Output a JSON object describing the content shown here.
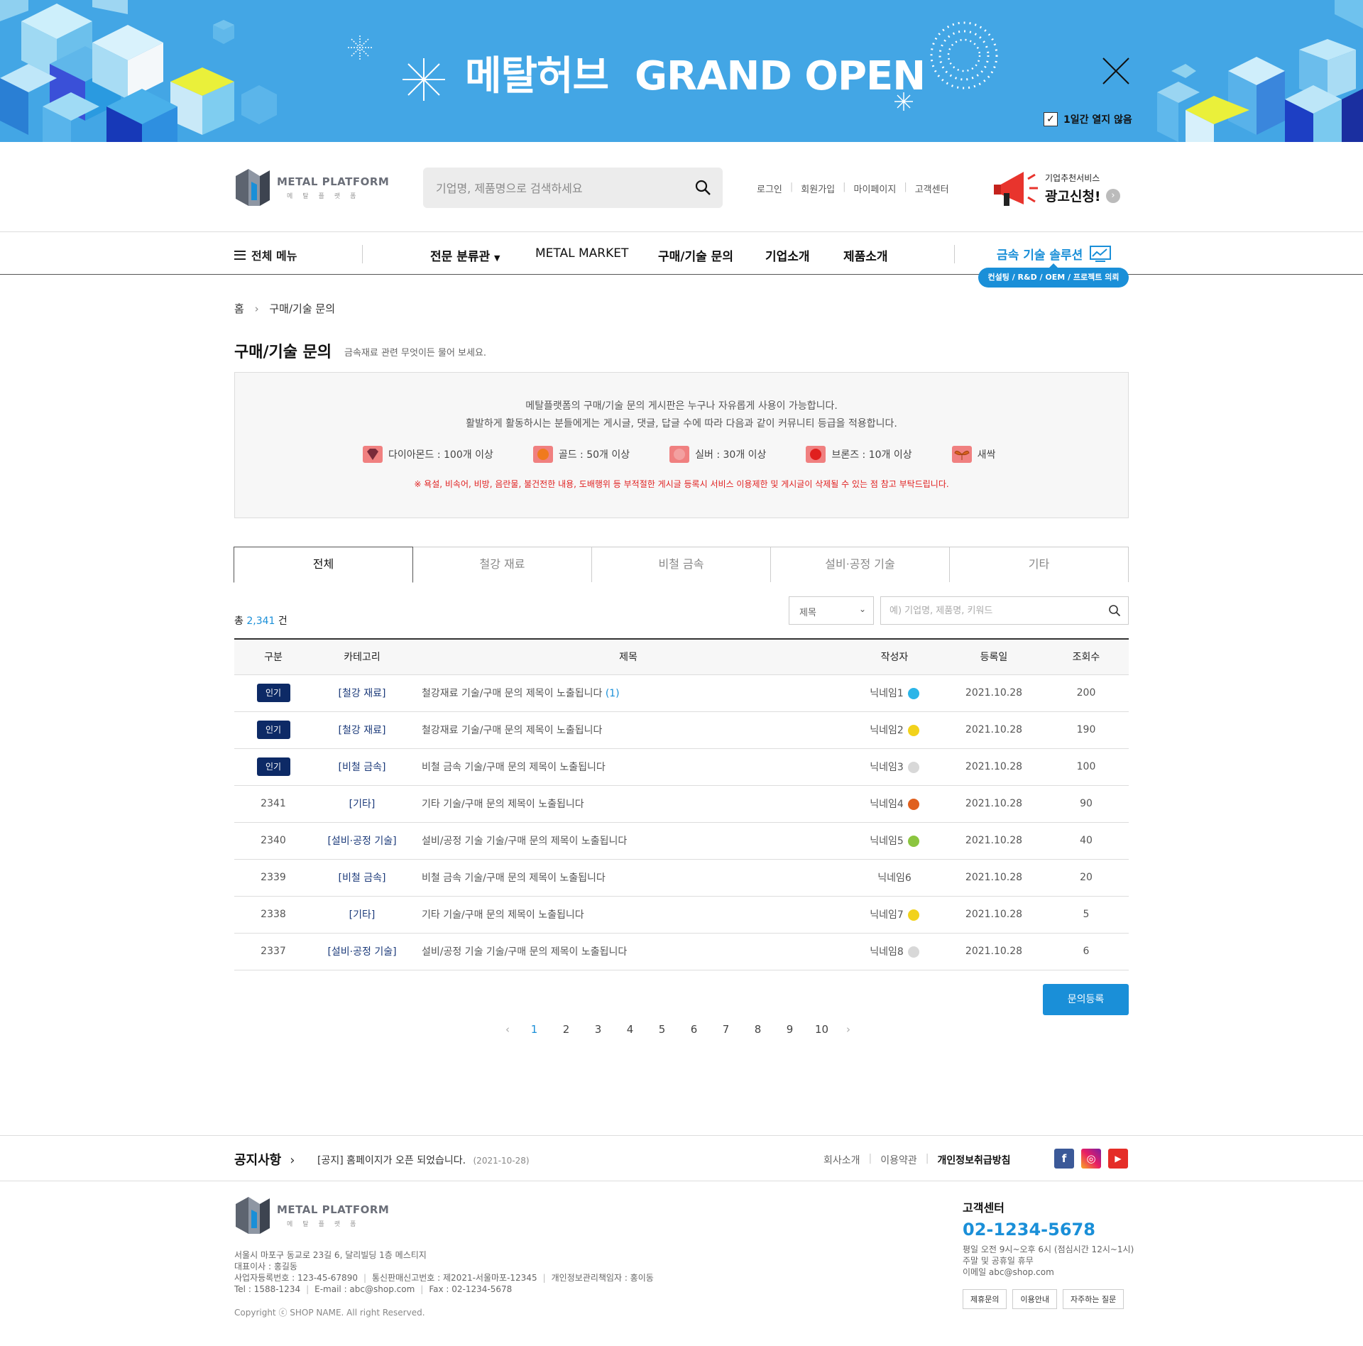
{
  "banner": {
    "title_kr": "메탈허브",
    "title_en": "GRAND OPEN",
    "no_show_label": "1일간 열지 않음",
    "close_icon": "close-icon"
  },
  "header": {
    "logo_text": "METAL PLATFORM",
    "logo_sub": "메탈플랫폼",
    "search_placeholder": "기업명, 제품명으로 검색하세요",
    "util_links": [
      "로그인",
      "회원가입",
      "마이페이지",
      "고객센터"
    ],
    "ad_sub": "기업추천서비스",
    "ad_main": "광고신청!"
  },
  "gnb": {
    "all_menu": "전체 메뉴",
    "menus": [
      "전문 분류관",
      "METAL MARKET",
      "구매/기술 문의",
      "기업소개",
      "제품소개"
    ],
    "solution": "금속 기술 솔루션",
    "solution_pill": "컨설팅 / R&D / OEM / 프로젝트 의뢰"
  },
  "breadcrumb": {
    "home": "홈",
    "current": "구매/기술 문의"
  },
  "page": {
    "title": "구매/기술 문의",
    "subtitle": "금속재료 관련 무엇이든 물어 보세요."
  },
  "info_box": {
    "line1": "메탈플랫폼의 구매/기술 문의 게시판은 누구나 자유롭게 사용이 가능합니다.",
    "line2": "활발하게 활동하시는 분들에게는 게시글, 댓글, 답글 수에 따라 다음과 같이 커뮤니티 등급을 적용합니다.",
    "grades": [
      "다이아몬드 : 100개 이상",
      "골드 : 50개 이상",
      "실버 : 30개 이상",
      "브론즈 : 10개 이상",
      "새싹"
    ],
    "warning": "※ 욕설, 비속어, 비방, 음란물, 불건전한 내용, 도배행위 등 부적절한 게시글 등록시 서비스 이용제한 및 게시글이 삭제될 수 있는 점 참고 부탁드립니다."
  },
  "tabs": [
    "전체",
    "철강 재료",
    "비철 금속",
    "설비·공정 기술",
    "기타"
  ],
  "board": {
    "total_prefix": "총",
    "total": "2,341",
    "total_suffix": "건",
    "select_value": "제목",
    "search_placeholder": "예) 기업명, 제품명, 키워드",
    "headers": [
      "구분",
      "카테고리",
      "제목",
      "작성자",
      "등록일",
      "조회수"
    ],
    "rows": [
      {
        "no": "인기",
        "hot": true,
        "cat": "[철강 재료]",
        "title": "철강재료 기술/구매 문의 제목이 노출됩니다",
        "comments": "(1)",
        "writer": "닉네임1",
        "level": "diamond",
        "date": "2021.10.28",
        "views": "200"
      },
      {
        "no": "인기",
        "hot": true,
        "cat": "[철강 재료]",
        "title": "철강재료 기술/구매 문의 제목이 노출됩니다",
        "comments": "",
        "writer": "닉네임2",
        "level": "gold",
        "date": "2021.10.28",
        "views": "190"
      },
      {
        "no": "인기",
        "hot": true,
        "cat": "[비철 금속]",
        "title": "비철 금속 기술/구매 문의 제목이 노출됩니다",
        "comments": "",
        "writer": "닉네임3",
        "level": "silver",
        "date": "2021.10.28",
        "views": "100"
      },
      {
        "no": "2341",
        "hot": false,
        "cat": "[기타]",
        "title": "기타 기술/구매 문의 제목이 노출됩니다",
        "comments": "",
        "writer": "닉네임4",
        "level": "bronze",
        "date": "2021.10.28",
        "views": "90"
      },
      {
        "no": "2340",
        "hot": false,
        "cat": "[설비·공정 기술]",
        "title": "설비/공정 기술 기술/구매 문의 제목이 노출됩니다",
        "comments": "",
        "writer": "닉네임5",
        "level": "sprout",
        "date": "2021.10.28",
        "views": "40"
      },
      {
        "no": "2339",
        "hot": false,
        "cat": "[비철 금속]",
        "title": "비철 금속 기술/구매 문의 제목이 노출됩니다",
        "comments": "",
        "writer": "닉네임6",
        "level": "none",
        "date": "2021.10.28",
        "views": "20"
      },
      {
        "no": "2338",
        "hot": false,
        "cat": "[기타]",
        "title": "기타 기술/구매 문의 제목이 노출됩니다",
        "comments": "",
        "writer": "닉네임7",
        "level": "gold",
        "date": "2021.10.28",
        "views": "5"
      },
      {
        "no": "2337",
        "hot": false,
        "cat": "[설비·공정 기술]",
        "title": "설비/공정 기술 기술/구매 문의 제목이 노출됩니다",
        "comments": "",
        "writer": "닉네임8",
        "level": "silver",
        "date": "2021.10.28",
        "views": "6"
      }
    ],
    "register_label": "문의등록",
    "pages": [
      "1",
      "2",
      "3",
      "4",
      "5",
      "6",
      "7",
      "8",
      "9",
      "10"
    ],
    "current_page": "1"
  },
  "level_colors": {
    "diamond": "#2bb5e8",
    "gold": "#f2d21b",
    "silver": "#d8d8d8",
    "bronze": "#e0601e",
    "sprout": "#8bc53f"
  },
  "footer": {
    "notice_title": "공지사항",
    "notice_text": "[공지] 홈페이지가 오픈 되었습니다.",
    "notice_date": "(2021-10-28)",
    "links": [
      "회사소개",
      "이용약관",
      "개인정보취급방침"
    ],
    "address": "서울시 마포구 동교로 23길 6, 달리빌딩 1층 메스티지",
    "ceo": "대표이사 : 홍길동",
    "biz_no": "사업자등록번호 : 123-45-67890",
    "mail_order": "통신판매신고번호 : 제2021-서울마포-12345",
    "privacy_officer": "개인정보관리책임자 : 홍이동",
    "tel": "Tel : 1588-1234",
    "email": "E-mail : abc@shop.com",
    "fax": "Fax : 02-1234-5678",
    "copyright": "Copyright ⓒ SHOP NAME. All right Reserved.",
    "cs_title": "고객센터",
    "cs_tel": "02-1234-5678",
    "cs_hours": "평일 오전 9시~오후 6시 (점심시간 12시~1시)",
    "cs_holiday": "주말 및 공휴일 휴무",
    "cs_email": "이메일 abc@shop.com",
    "cs_buttons": [
      "제휴문의",
      "이용안내",
      "자주하는 질문"
    ]
  }
}
